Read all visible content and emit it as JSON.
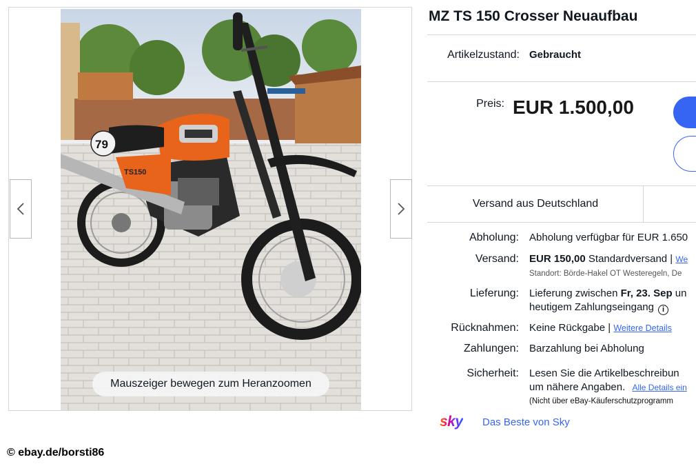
{
  "listing": {
    "title": "MZ TS 150 Crosser Neuaufbau",
    "condition_label": "Artikelzustand:",
    "condition_value": "Gebraucht",
    "price_label": "Preis:",
    "price_value": "EUR 1.500,00"
  },
  "gallery": {
    "zoom_hint": "Mauszeiger bewegen zum Heranzoomen",
    "plate_number": "79",
    "tank_label": "TS150"
  },
  "shipping_tab": {
    "label": "Versand aus Deutschland"
  },
  "details": {
    "pickup": {
      "label": "Abholung:",
      "value": "Abholung verfügbar für EUR 1.650"
    },
    "shipping": {
      "label": "Versand:",
      "price": "EUR 150,00",
      "method": "Standardversand |",
      "link": "We",
      "location": "Standort: Börde-Hakel OT Westeregeln, De"
    },
    "delivery": {
      "label": "Lieferung:",
      "prefix": "Lieferung zwischen ",
      "date": "Fr, 23. Sep",
      "suffix": " un",
      "line2": "heutigem Zahlungseingang",
      "icon": "info-icon"
    },
    "returns": {
      "label": "Rücknahmen:",
      "value": "Keine Rückgabe |",
      "link": "Weitere Details"
    },
    "payments": {
      "label": "Zahlungen:",
      "value": "Barzahlung bei Abholung"
    },
    "security": {
      "label": "Sicherheit:",
      "line1": "Lesen Sie die Artikelbeschreibun",
      "line2": "um nähere Angaben.",
      "link": "Alle Details ein",
      "note": "(Nicht über eBay-Käuferschutzprogramm"
    }
  },
  "promo": {
    "logo": "sky",
    "link": "Das Beste von Sky"
  },
  "watermark": "© ebay.de/borsti86",
  "colors": {
    "accent": "#3665f3",
    "text": "#111820",
    "border": "#d6d6d6",
    "bike_orange": "#e8641a"
  }
}
